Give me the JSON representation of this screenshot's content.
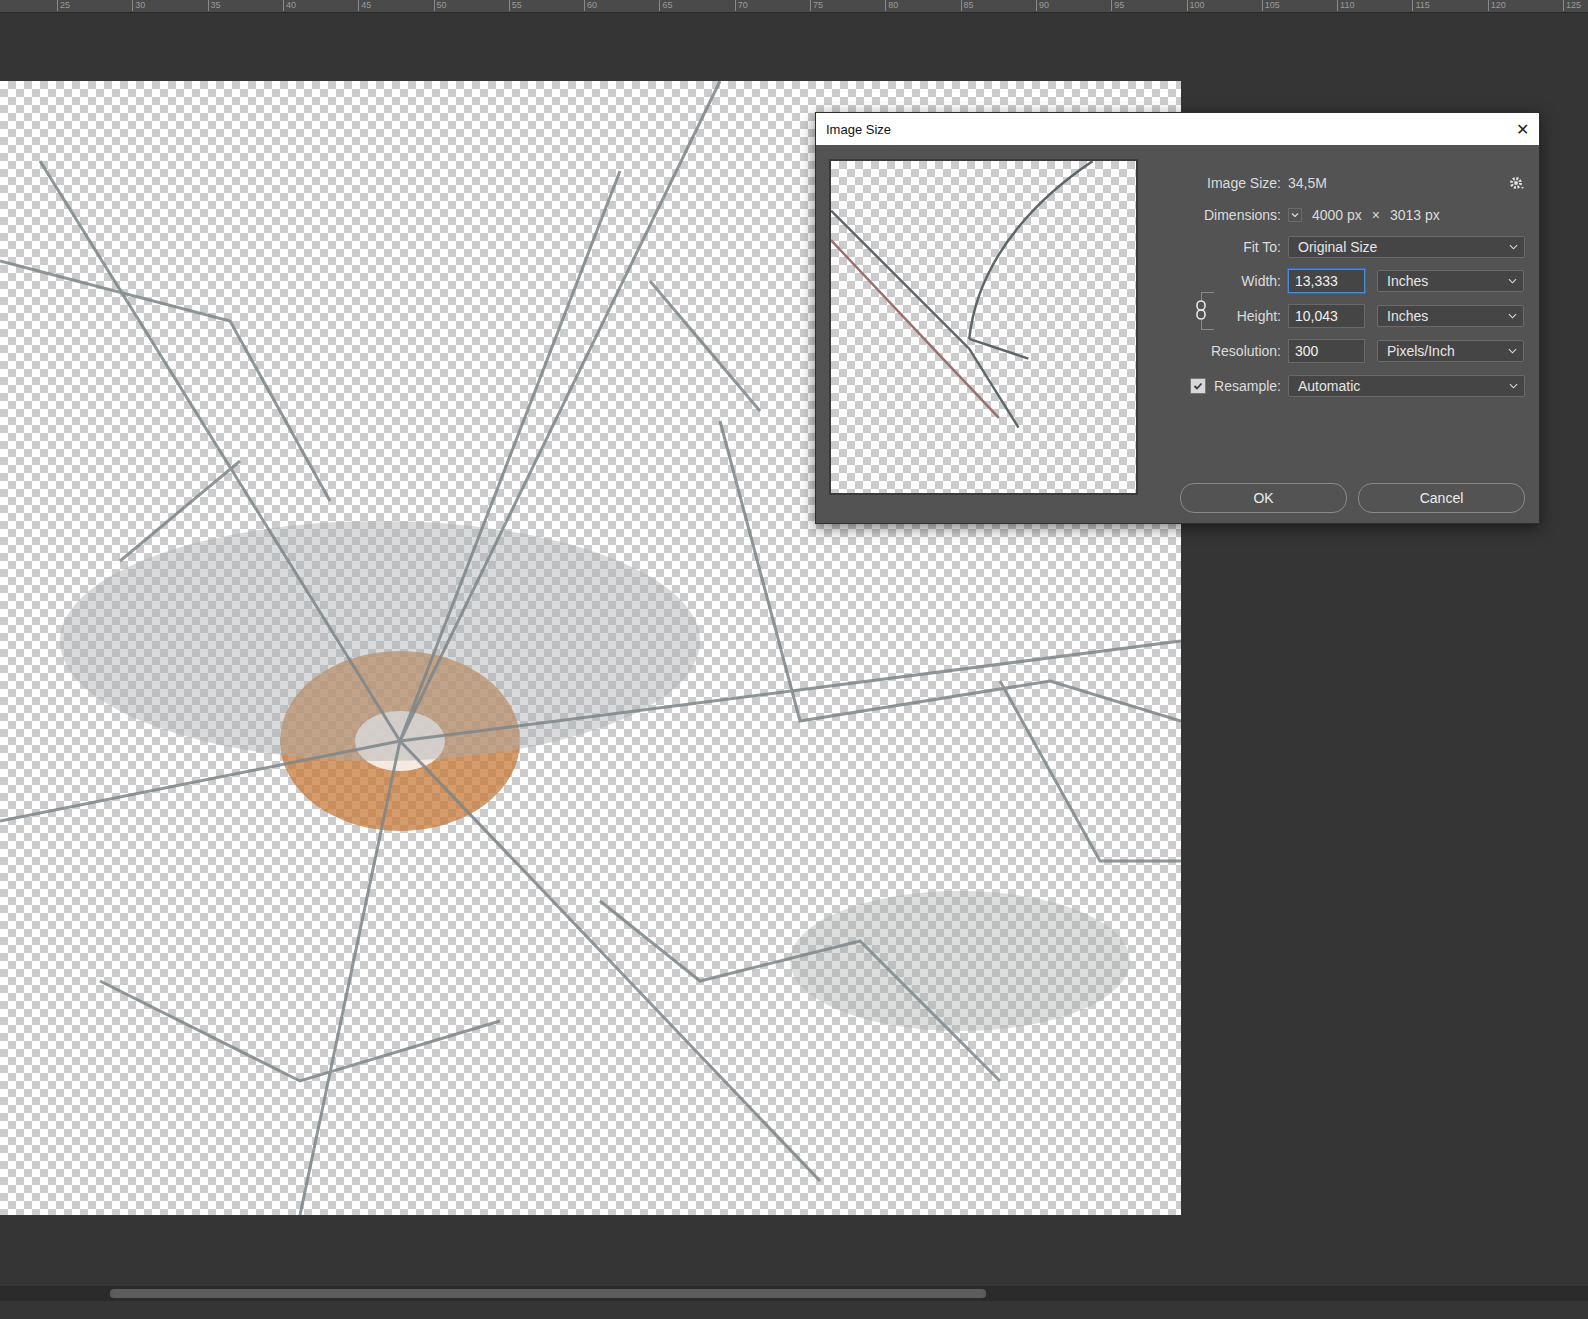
{
  "ruler": {
    "ticks": [
      "25",
      "30",
      "35",
      "40",
      "45",
      "50",
      "55",
      "60",
      "65",
      "70",
      "75",
      "80",
      "85",
      "90",
      "95",
      "100",
      "105",
      "110",
      "115",
      "120",
      "125"
    ]
  },
  "dialog": {
    "title": "Image Size",
    "close": "✕",
    "image_size": {
      "label": "Image Size:",
      "value": "34,5M"
    },
    "dimensions": {
      "label": "Dimensions:",
      "width": "4000 px",
      "times": "×",
      "height": "3013 px"
    },
    "fit_to": {
      "label": "Fit To:",
      "value": "Original Size"
    },
    "width": {
      "label": "Width:",
      "value": "13,333",
      "unit": "Inches",
      "focused": true
    },
    "height": {
      "label": "Height:",
      "value": "10,043",
      "unit": "Inches",
      "focused": false
    },
    "resolution": {
      "label": "Resolution:",
      "value": "300",
      "unit": "Pixels/Inch",
      "focused": false
    },
    "resample": {
      "label": "Resample:",
      "checked": true,
      "value": "Automatic"
    },
    "constrain_linked": true,
    "buttons": [
      {
        "label": "OK",
        "selected": false
      },
      {
        "label": "Cancel",
        "selected": false
      }
    ]
  },
  "horizontal_scrollbar": {
    "start": 0.069,
    "level": 0.552
  }
}
